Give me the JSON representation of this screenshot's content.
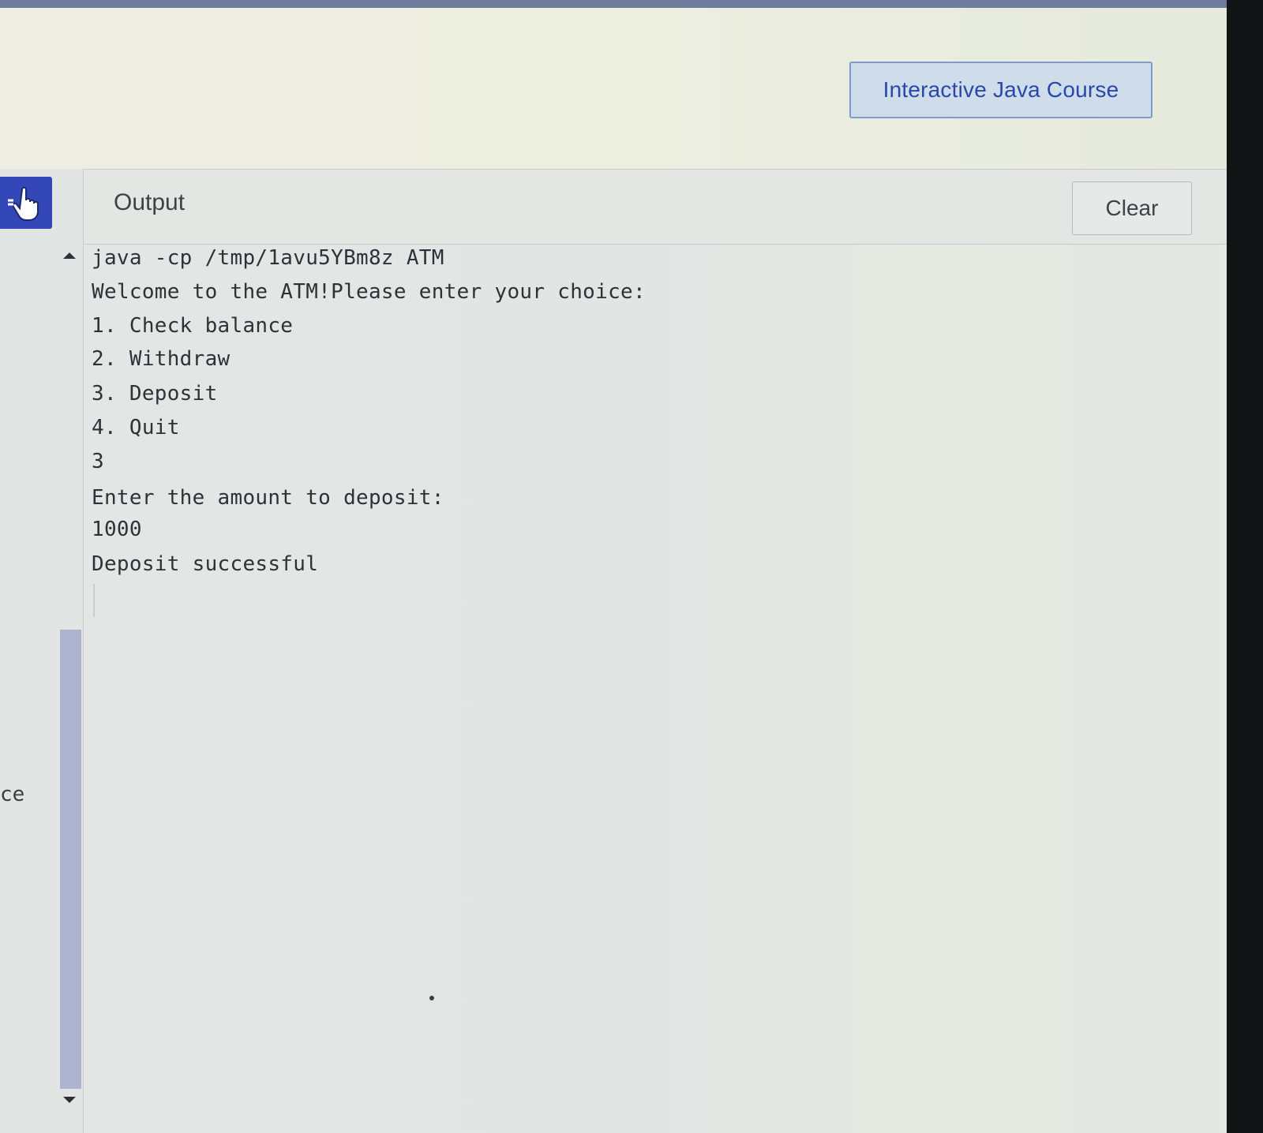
{
  "header": {
    "course_button_label": "Interactive Java Course"
  },
  "left_rail": {
    "partial_label": "ce"
  },
  "output_panel": {
    "title": "Output",
    "clear_label": "Clear",
    "lines": [
      "java -cp /tmp/1avu5YBm8z ATM",
      "Welcome to the ATM!Please enter your choice:",
      "1. Check balance",
      "2. Withdraw",
      "3. Deposit",
      "4. Quit",
      "3",
      "Enter the amount to deposit:",
      "1000",
      "Deposit successful"
    ]
  },
  "icons": {
    "run": "hand-pointer-icon",
    "scroll_up": "triangle-up-icon",
    "scroll_down": "triangle-down-icon"
  },
  "colors": {
    "run_button": "#3347b8",
    "course_button_text": "#2948a8",
    "course_button_bg": "#cfdcea",
    "scroll_thumb": "#aeb4cf"
  }
}
